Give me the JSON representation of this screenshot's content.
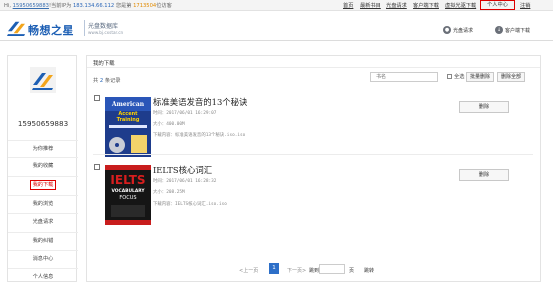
{
  "topbar": {
    "greeting_prefix": "Hi,",
    "username": "15950659883",
    "mid_text": "!当前IP为",
    "ip": "183.134.66.112",
    "visit_label": "您是第",
    "visit_count": "1713504",
    "visit_suffix": "位访客",
    "links": [
      "首页",
      "最新书目",
      "光盘请求",
      "客户端下载",
      "虚拟光驱下载"
    ],
    "personal_center": "个人中心",
    "logout": "注销"
  },
  "header": {
    "logo_text": "畅想之星",
    "logo_sub": "光盘数据库",
    "logo_url": "www.bj.cxstar.cn",
    "btn_request": "光盘请求",
    "btn_client": "客户端下载"
  },
  "sidebar": {
    "user_id": "15950659883",
    "menu": [
      "为你推荐",
      "我的收藏",
      "我的下载",
      "我的浏览",
      "光盘请求",
      "我的纠错",
      "消息中心",
      "个人信息"
    ],
    "active_index": 2
  },
  "main": {
    "title": "我的下载",
    "records_prefix": "共",
    "records_count": "2",
    "records_suffix": "条记录",
    "search_placeholder": "书名",
    "select_all": "全选",
    "batch_delete": "批量删除",
    "delete_all": "删除全部",
    "items": [
      {
        "title": "标准美语发音的13个秘诀",
        "time_label": "时间：",
        "time": "2017/06/01 16:29:07",
        "size_label": "大小：",
        "size": "400.00M",
        "content_label": "下载内容：",
        "content": "标准美语发音的13个秘诀.iso.iso",
        "delete": "删除",
        "cover_lines": [
          "American",
          "Accent",
          "Training"
        ]
      },
      {
        "title": "IELTS核心词汇",
        "time_label": "时间：",
        "time": "2017/06/01 16:28:32",
        "size_label": "大小：",
        "size": "208.25M",
        "content_label": "下载内容：",
        "content": "IELTS核心词汇.iso.iso",
        "delete": "删除",
        "cover_lines": [
          "IELTS",
          "VOCABULARY",
          "FOCUS"
        ]
      }
    ]
  },
  "pagination": {
    "prev": "<上一页",
    "current": "1",
    "next": "下一页>",
    "jump_label": "跳到",
    "page_suffix": "页",
    "go": "跳转"
  },
  "colors": {
    "accent": "#1d5fb4",
    "active_border": "#dd0000",
    "page_current": "#2d6fc8"
  }
}
